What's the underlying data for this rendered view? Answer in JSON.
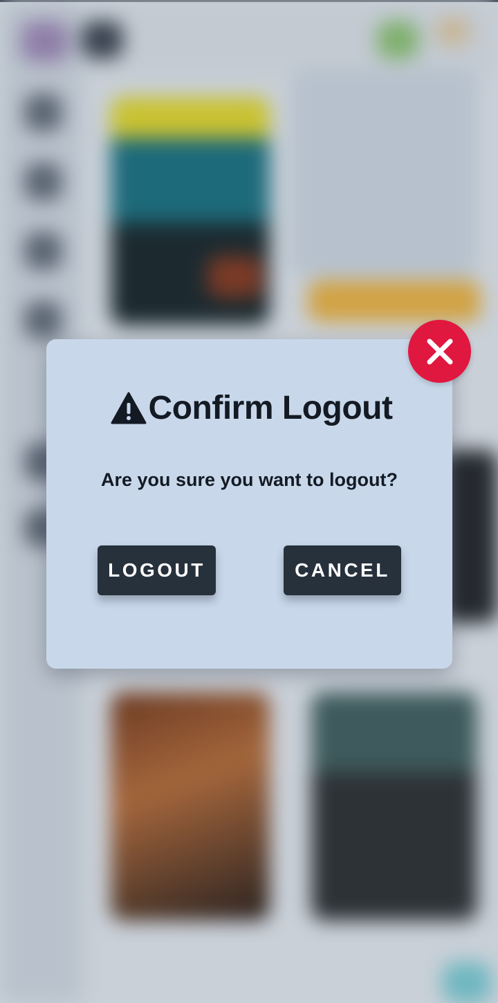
{
  "dialog": {
    "title": "Confirm Logout",
    "title_icon": "warning-triangle-icon",
    "message": "Are you sure you want to logout?",
    "logout_label": "LOGOUT",
    "cancel_label": "CANCEL",
    "close_icon": "close-icon"
  },
  "colors": {
    "dialog_background": "#c8d8ea",
    "button_background": "#27313c",
    "close_button": "#e0173f",
    "text": "#141a24"
  }
}
